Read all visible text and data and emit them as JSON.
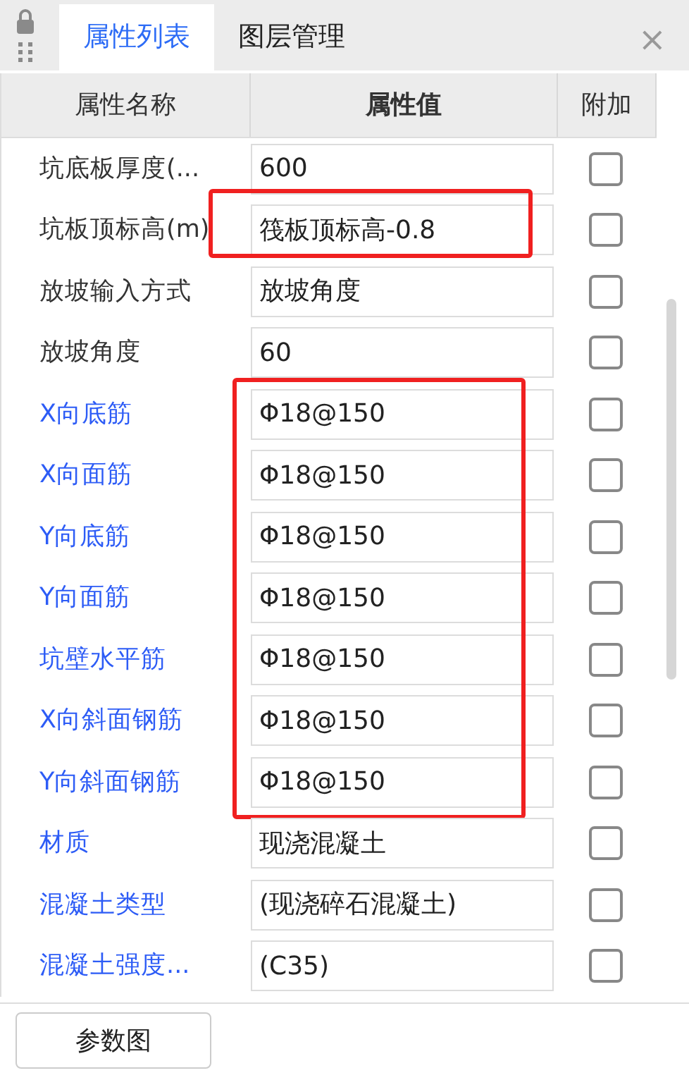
{
  "tabs": [
    {
      "label": "属性列表",
      "selected": true
    },
    {
      "label": "图层管理",
      "selected": false
    }
  ],
  "close": "×",
  "columns": [
    "属性名称",
    "属性值",
    "附加"
  ],
  "row_groups": [
    {
      "highlighted": false,
      "rows": [
        {
          "name": "坑底板厚度(...",
          "color": "#333333",
          "value": "600",
          "checked": false
        }
      ]
    },
    {
      "highlighted": true,
      "rows": [
        {
          "name": "坑板顶标高(m)",
          "color": "#333333",
          "value": "筏板顶标高-0.8",
          "checked": false
        }
      ]
    },
    {
      "highlighted": false,
      "rows": [
        {
          "name": "放坡输入方式",
          "color": "#333333",
          "value": "放坡角度",
          "checked": false
        },
        {
          "name": "放坡角度",
          "color": "#333333",
          "value": "60",
          "checked": false
        }
      ]
    },
    {
      "highlighted": true,
      "rows": [
        {
          "name": "X向底筋",
          "color": "#2d5cf6",
          "value": "Φ18@150",
          "checked": false
        },
        {
          "name": "X向面筋",
          "color": "#2d5cf6",
          "value": "Φ18@150",
          "checked": false
        },
        {
          "name": "Y向底筋",
          "color": "#2d5cf6",
          "value": "Φ18@150",
          "checked": false
        },
        {
          "name": "Y向面筋",
          "color": "#2d5cf6",
          "value": "Φ18@150",
          "checked": false
        },
        {
          "name": "坑壁水平筋",
          "color": "#2d5cf6",
          "value": "Φ18@150",
          "checked": false
        },
        {
          "name": "X向斜面钢筋",
          "color": "#2d5cf6",
          "value": "Φ18@150",
          "checked": false
        },
        {
          "name": "Y向斜面钢筋",
          "color": "#2d5cf6",
          "value": "Φ18@150",
          "checked": false
        }
      ]
    },
    {
      "highlighted": false,
      "rows": [
        {
          "name": "材质",
          "color": "#2d5cf6",
          "value": "现浇混凝土",
          "checked": false
        },
        {
          "name": "混凝土类型",
          "color": "#2d5cf6",
          "value": "(现浇碎石混凝土)",
          "checked": false
        },
        {
          "name": "混凝土强度...",
          "color": "#2d5cf6",
          "value": "(C35)",
          "checked": false
        }
      ]
    }
  ],
  "button": "参数图"
}
